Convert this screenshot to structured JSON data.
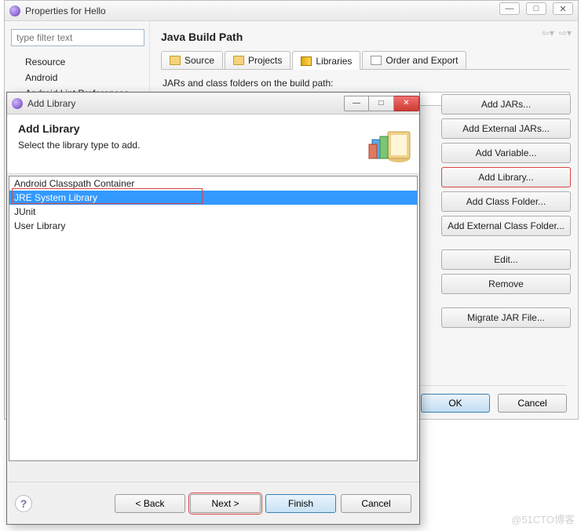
{
  "parent": {
    "title": "Properties for Hello",
    "filter_placeholder": "type filter text",
    "tree": {
      "items": [
        "Resource",
        "Android",
        "Android Lint Preferences"
      ]
    },
    "section_title": "Java Build Path",
    "tabs": {
      "source": "Source",
      "projects": "Projects",
      "libraries": "Libraries",
      "order": "Order and Export"
    },
    "subtext": "JARs and class folders on the build path:",
    "buttons": {
      "add_jars": "Add JARs...",
      "add_external_jars": "Add External JARs...",
      "add_variable": "Add Variable...",
      "add_library": "Add Library...",
      "add_class_folder": "Add Class Folder...",
      "add_external_class_folder": "Add External Class Folder...",
      "edit": "Edit...",
      "remove": "Remove",
      "migrate": "Migrate JAR File..."
    },
    "ok": "OK",
    "cancel": "Cancel"
  },
  "modal": {
    "window_title": "Add Library",
    "heading": "Add Library",
    "subheading": "Select the library type to add.",
    "list": {
      "items": [
        "Android Classpath Container",
        "JRE System Library",
        "JUnit",
        "User Library"
      ],
      "selected_index": 1
    },
    "buttons": {
      "back": "< Back",
      "next": "Next >",
      "finish": "Finish",
      "cancel": "Cancel"
    }
  },
  "watermark": "@51CTO博客"
}
